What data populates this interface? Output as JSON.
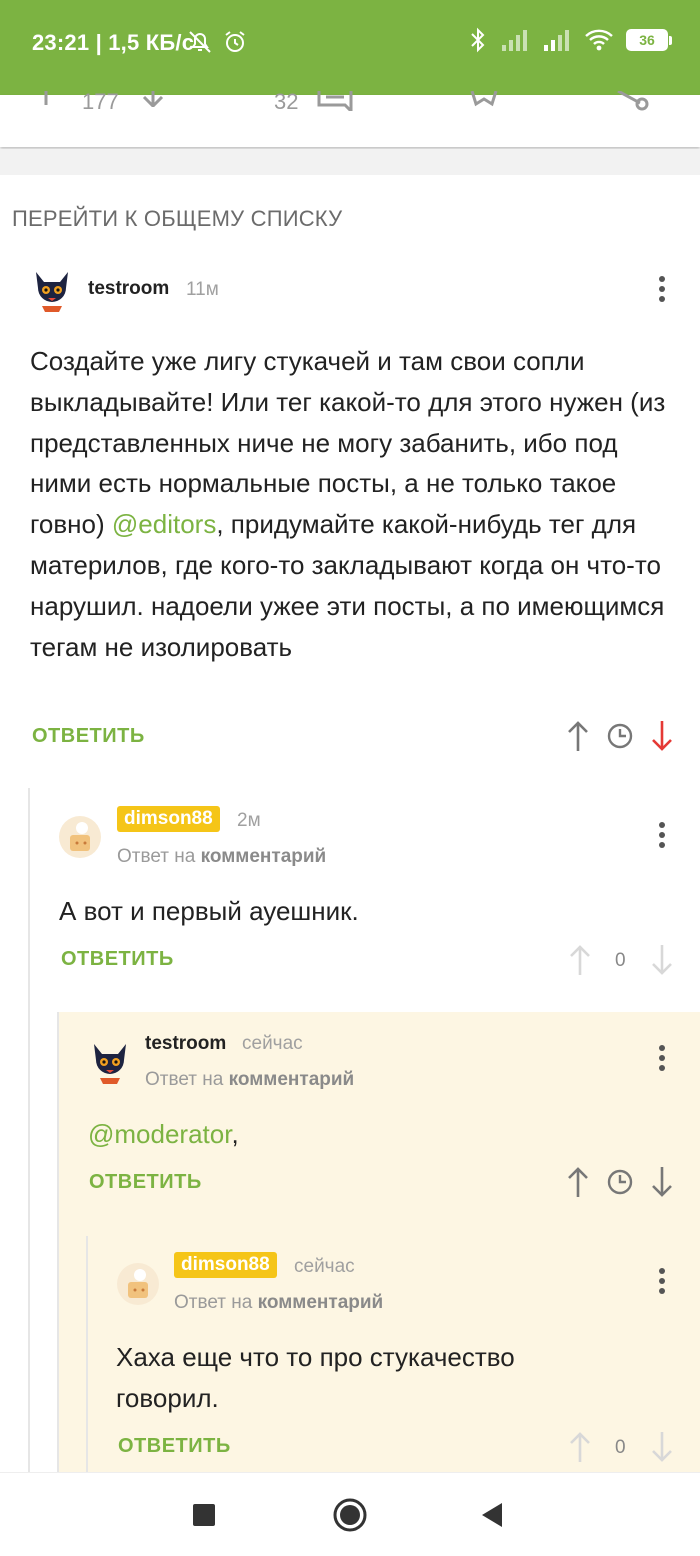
{
  "status": {
    "time": "23:21 | 1,5 КБ/с",
    "battery": "36"
  },
  "post_actions": {
    "rating": "177",
    "comments_count": "32"
  },
  "section_link": "ПЕРЕЙТИ К ОБЩЕМУ СПИСКУ",
  "comments": [
    {
      "username": "testroom",
      "time": "11м",
      "text_before_mention": "Создайте уже лигу стукачей и там свои сопли выкладывайте! Или тег какой-то для этого нужен (из представленных ниче не могу забанить, ибо под ними есть нормальные посты, а не только такое говно) ",
      "mention": "@editors",
      "text_after_mention": ", придумайте какой-нибудь тег для материлов, где кого-то закладывают когда он что-то нарушил. надоели ужее эти посты, а по имеющимся тегам не изолировать",
      "reply_label": "ОТВЕТИТЬ"
    },
    {
      "username": "dimson88",
      "time": "2м",
      "reply_prefix": "Ответ на",
      "reply_target": "комментарий",
      "text": "А вот и первый ауешник.",
      "score": "0",
      "reply_label": "ОТВЕТИТЬ"
    },
    {
      "username": "testroom",
      "time": "сейчас",
      "reply_prefix": "Ответ на",
      "reply_target": "комментарий",
      "mention": "@moderator",
      "text_after_mention": ",",
      "reply_label": "ОТВЕТИТЬ"
    },
    {
      "username": "dimson88",
      "time": "сейчас",
      "reply_prefix": "Ответ на",
      "reply_target": "комментарий",
      "text": "Хаха еще что то про стукачество говорил.",
      "score": "0",
      "reply_label": "ОТВЕТИТЬ"
    }
  ],
  "colors": {
    "accent": "#7cb342",
    "badge": "#f5c518",
    "downvote_active": "#e53935",
    "highlight_bg": "#fdf6e3"
  }
}
